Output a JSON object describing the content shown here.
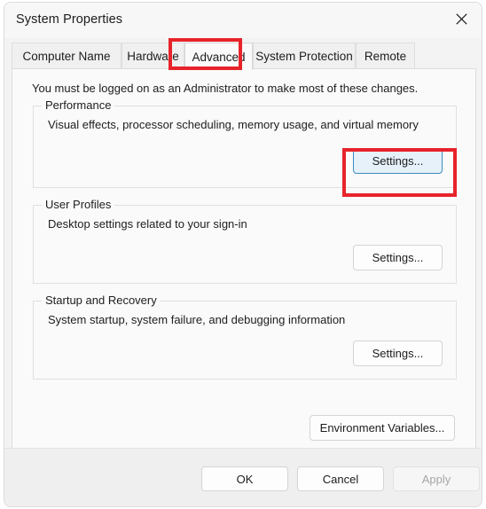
{
  "window": {
    "title": "System Properties",
    "close_icon": "close-icon"
  },
  "tabs": [
    {
      "label": "Computer Name",
      "selected": false
    },
    {
      "label": "Hardware",
      "selected": false
    },
    {
      "label": "Advanced",
      "selected": true
    },
    {
      "label": "System Protection",
      "selected": false
    },
    {
      "label": "Remote",
      "selected": false
    }
  ],
  "main": {
    "admin_note": "You must be logged on as an Administrator to make most of these changes.",
    "groups": [
      {
        "label": "Performance",
        "description": "Visual effects, processor scheduling, memory usage, and virtual memory",
        "button": "Settings..."
      },
      {
        "label": "User Profiles",
        "description": "Desktop settings related to your sign-in",
        "button": "Settings..."
      },
      {
        "label": "Startup and Recovery",
        "description": "System startup, system failure, and debugging information",
        "button": "Settings..."
      }
    ],
    "environment_variables_button": "Environment Variables..."
  },
  "footer": {
    "ok": "OK",
    "cancel": "Cancel",
    "apply": "Apply"
  },
  "annotations": {
    "highlight_color": "#e8232a",
    "targets": [
      "Advanced tab",
      "Performance Settings... button"
    ]
  }
}
